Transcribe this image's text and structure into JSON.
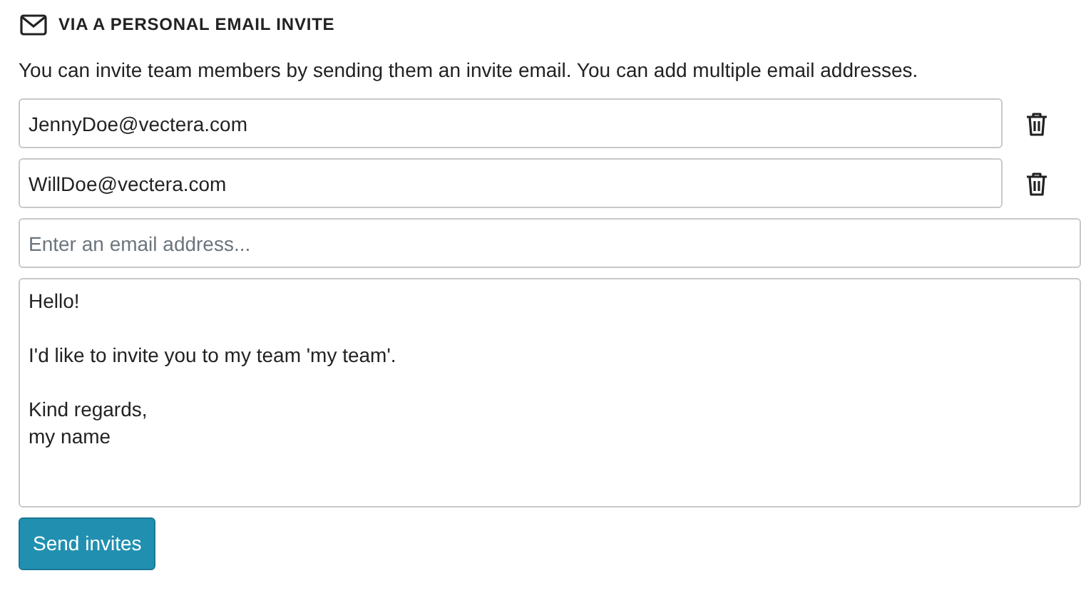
{
  "section": {
    "title": "VIA A PERSONAL EMAIL INVITE",
    "description": "You can invite team members by sending them an invite email. You can add multiple email addresses."
  },
  "emails": [
    {
      "value": "JennyDoe@vectera.com",
      "removable": true
    },
    {
      "value": "WillDoe@vectera.com",
      "removable": true
    }
  ],
  "new_email": {
    "placeholder": "Enter an email address..."
  },
  "message": "Hello!\n\nI'd like to invite you to my team 'my team'.\n\nKind regards,\nmy name",
  "send_button": "Send invites"
}
